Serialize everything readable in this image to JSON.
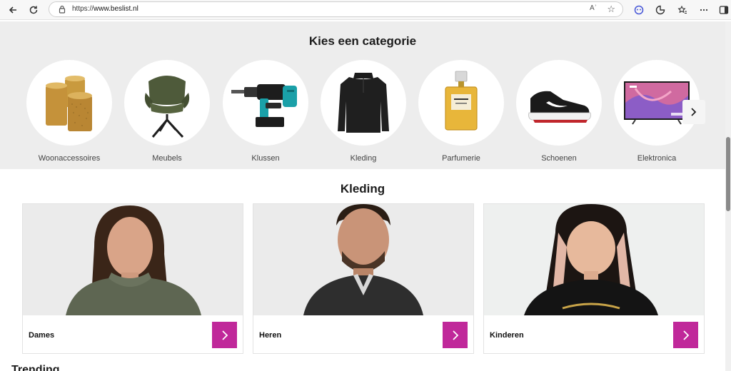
{
  "browser": {
    "url_scheme": "https://",
    "url_host": "www.beslist.nl",
    "read_aloud_label": "Aʾ"
  },
  "categories_section": {
    "title": "Kies een categorie",
    "items": [
      {
        "label": "Woonaccessoires",
        "icon": "candles-image"
      },
      {
        "label": "Meubels",
        "icon": "chair-image"
      },
      {
        "label": "Klussen",
        "icon": "drill-image"
      },
      {
        "label": "Kleding",
        "icon": "sweater-image"
      },
      {
        "label": "Parfumerie",
        "icon": "perfume-image"
      },
      {
        "label": "Schoenen",
        "icon": "sneaker-image"
      },
      {
        "label": "Elektronica",
        "icon": "tv-image"
      }
    ]
  },
  "kleding_section": {
    "title": "Kleding",
    "cards": [
      {
        "label": "Dames"
      },
      {
        "label": "Heren"
      },
      {
        "label": "Kinderen"
      }
    ]
  },
  "trending_title": "Trending",
  "colors": {
    "accent": "#c0289a",
    "category_bg": "#ededed"
  }
}
